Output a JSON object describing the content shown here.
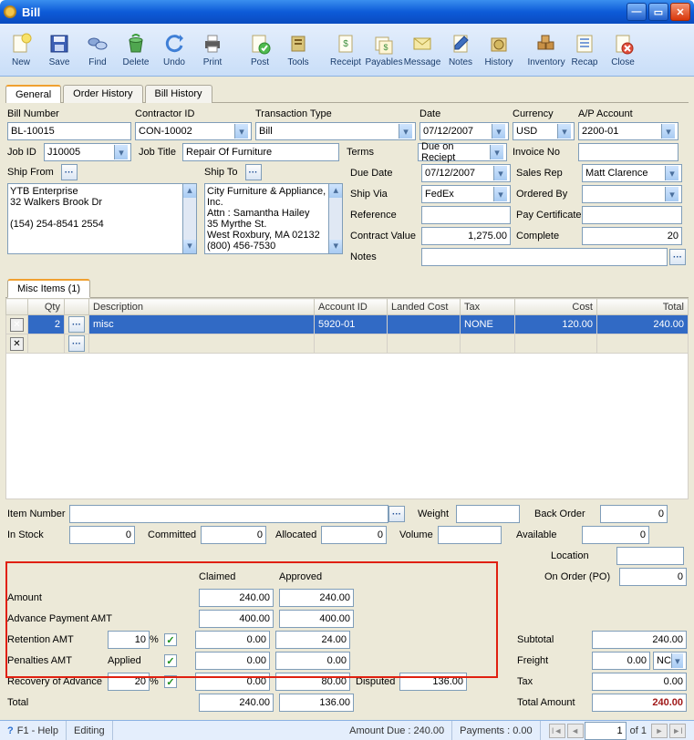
{
  "window": {
    "title": "Bill"
  },
  "toolbar": [
    {
      "label": "New",
      "icon": "new"
    },
    {
      "label": "Save",
      "icon": "save"
    },
    {
      "label": "Find",
      "icon": "find"
    },
    {
      "label": "Delete",
      "icon": "delete"
    },
    {
      "label": "Undo",
      "icon": "undo"
    },
    {
      "label": "Print",
      "icon": "print"
    },
    {
      "label": "",
      "sep": true
    },
    {
      "label": "Post",
      "icon": "post"
    },
    {
      "label": "Tools",
      "icon": "tools"
    },
    {
      "label": "",
      "sep": true
    },
    {
      "label": "Receipt",
      "icon": "receipt"
    },
    {
      "label": "Payables",
      "icon": "payables"
    },
    {
      "label": "Message",
      "icon": "message"
    },
    {
      "label": "Notes",
      "icon": "notes"
    },
    {
      "label": "History",
      "icon": "history"
    },
    {
      "label": "",
      "sep": true
    },
    {
      "label": "Inventory",
      "icon": "inventory"
    },
    {
      "label": "Recap",
      "icon": "recap"
    },
    {
      "label": "Close",
      "icon": "close"
    }
  ],
  "tabs": {
    "general": "General",
    "orderhistory": "Order History",
    "billhistory": "Bill History"
  },
  "header": {
    "billnum_lbl": "Bill Number",
    "billnum": "BL-10015",
    "contractor_lbl": "Contractor ID",
    "contractor": "CON-10002",
    "transtype_lbl": "Transaction Type",
    "transtype": "Bill",
    "date_lbl": "Date",
    "date": "07/12/2007",
    "currency_lbl": "Currency",
    "currency": "USD",
    "ap_lbl": "A/P Account",
    "ap": "2200-01",
    "jobid_lbl": "Job ID",
    "jobid": "J10005",
    "jobtitle_lbl": "Job Title",
    "jobtitle": "Repair Of Furniture",
    "terms_lbl": "Terms",
    "terms": "Due on Reciept",
    "invoice_lbl": "Invoice No",
    "invoice": "",
    "duedate_lbl": "Due Date",
    "duedate": "07/12/2007",
    "salesrep_lbl": "Sales Rep",
    "salesrep": "Matt Clarence",
    "shipvia_lbl": "Ship Via",
    "shipvia": "FedEx",
    "orderedby_lbl": "Ordered By",
    "orderedby": "",
    "reference_lbl": "Reference",
    "reference": "",
    "paycert_lbl": "Pay Certificate",
    "paycert": "",
    "contractval_lbl": "Contract Value",
    "contractval": "1,275.00",
    "complete_lbl": "Complete",
    "complete": "20",
    "notes_lbl": "Notes",
    "notes": "",
    "shipfrom_lbl": "Ship From",
    "shipto_lbl": "Ship To",
    "shipfrom": "YTB Enterprise\n32 Walkers Brook Dr\n\n(154) 254-8541 2554",
    "shipto": "City Furniture & Appliance, Inc.\nAttn : Samantha Hailey\n35 Myrthe St.\nWest Roxbury, MA 02132\n(800) 456-7530"
  },
  "gridTab": "Misc Items (1)",
  "gridCols": {
    "qty": "Qty",
    "desc": "Description",
    "acct": "Account ID",
    "landed": "Landed Cost",
    "tax": "Tax",
    "cost": "Cost",
    "total": "Total"
  },
  "gridRows": [
    {
      "qty": "2",
      "desc": "misc",
      "acct": "5920-01",
      "landed": "",
      "tax": "NONE",
      "cost": "120.00",
      "total": "240.00"
    },
    {
      "qty": "",
      "desc": "",
      "acct": "",
      "landed": "",
      "tax": "",
      "cost": "",
      "total": ""
    }
  ],
  "mid": {
    "itemnum_lbl": "Item Number",
    "itemnum": "",
    "weight_lbl": "Weight",
    "weight": "",
    "backorder_lbl": "Back Order",
    "backorder": "0",
    "instock_lbl": "In Stock",
    "instock": "0",
    "committed_lbl": "Committed",
    "committed": "0",
    "allocated_lbl": "Allocated",
    "allocated": "0",
    "volume_lbl": "Volume",
    "volume": "",
    "available_lbl": "Available",
    "available": "0",
    "location_lbl": "Location",
    "location": "",
    "onorder_lbl": "On Order (PO)",
    "onorder": "0"
  },
  "fin": {
    "claimed_lbl": "Claimed",
    "approved_lbl": "Approved",
    "amount_lbl": "Amount",
    "amount_c": "240.00",
    "amount_a": "240.00",
    "adv_lbl": "Advance Payment AMT",
    "adv_c": "400.00",
    "adv_a": "400.00",
    "ret_lbl": "Retention AMT",
    "ret_pct": "10",
    "pct": "%",
    "ret_c": "0.00",
    "ret_a": "24.00",
    "pen_lbl": "Penalties AMT",
    "applied_lbl": "Applied",
    "pen_c": "0.00",
    "pen_a": "0.00",
    "rec_lbl": "Recovery of Advance",
    "rec_pct": "20",
    "rec_c": "0.00",
    "rec_a": "80.00",
    "disputed_lbl": "Disputed",
    "disputed": "136.00",
    "total_lbl": "Total",
    "total_c": "240.00",
    "total_a": "136.00",
    "subtotal_lbl": "Subtotal",
    "subtotal": "240.00",
    "freight_lbl": "Freight",
    "freight": "0.00",
    "freight_code": "NC",
    "tax_lbl": "Tax",
    "tax": "0.00",
    "totalamount_lbl": "Total Amount",
    "totalamount": "240.00"
  },
  "status": {
    "help_icon": "?",
    "help": "F1 - Help",
    "editing": "Editing",
    "amtdue": "Amount Due : 240.00",
    "payments": "Payments : 0.00",
    "page": "1",
    "of": "of  1"
  }
}
